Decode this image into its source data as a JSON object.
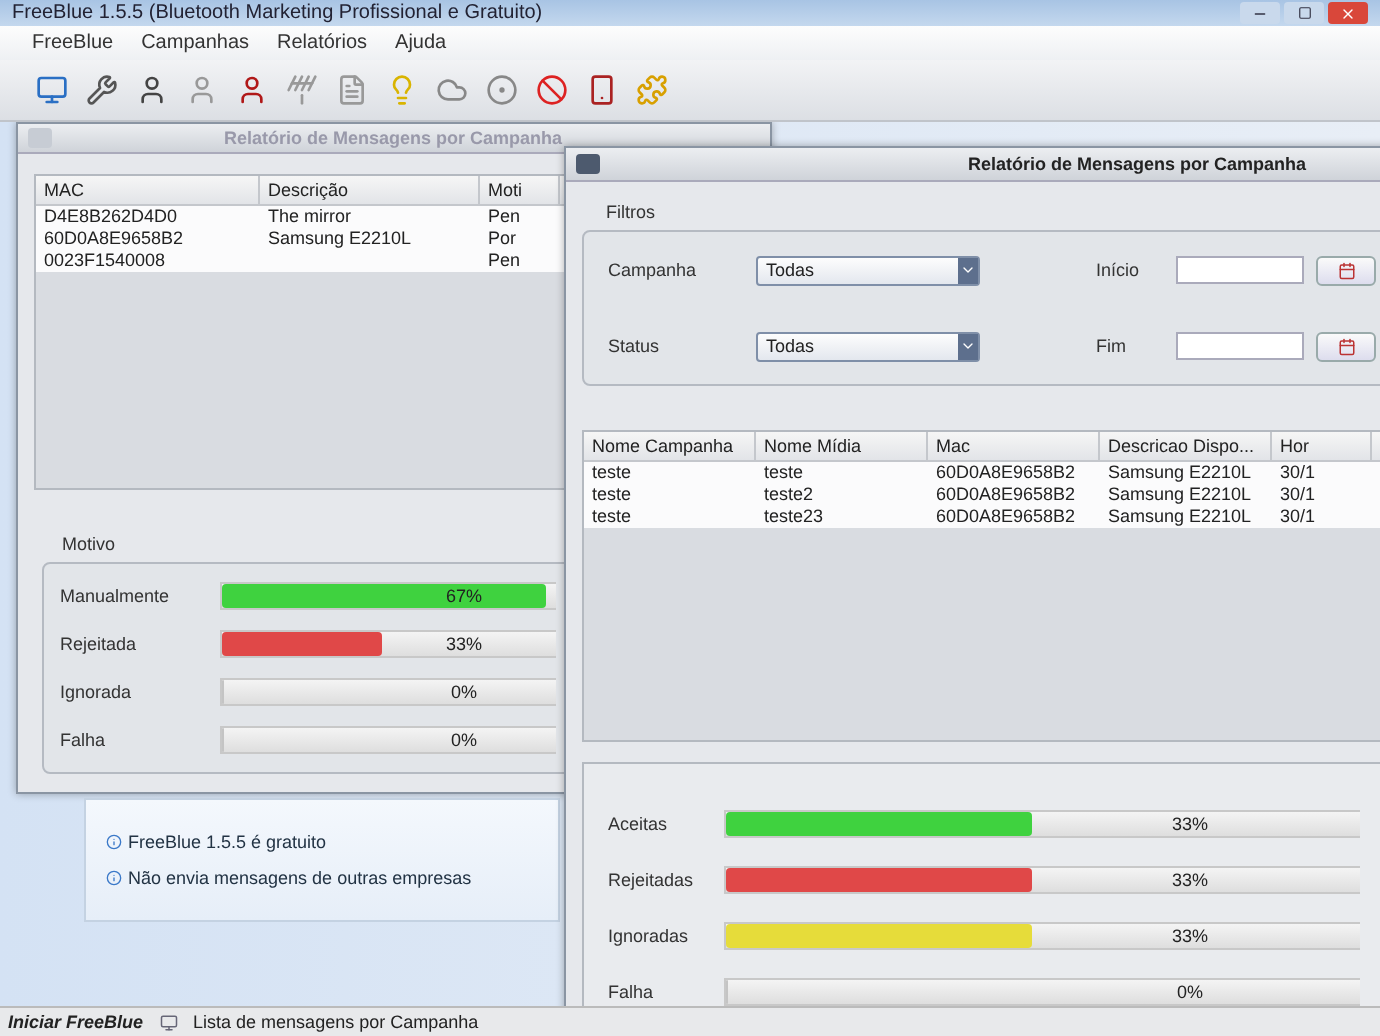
{
  "window": {
    "title": "FreeBlue 1.5.5 (Bluetooth Marketing Profissional e Gratuito)"
  },
  "menu": [
    "FreeBlue",
    "Campanhas",
    "Relatórios",
    "Ajuda"
  ],
  "back_report": {
    "title": "Relatório de Mensagens por Campanha",
    "columns": [
      "MAC",
      "Descrição",
      "Moti"
    ],
    "rows": [
      [
        "D4E8B262D4D0",
        "The mirror",
        "Pen"
      ],
      [
        "60D0A8E9658B2",
        "Samsung E2210L",
        "Por"
      ],
      [
        "0023F1540008",
        "",
        "Pen"
      ]
    ],
    "reasons_label": "Motivo",
    "bars": [
      {
        "label": "Manualmente",
        "level": 0.67,
        "reading": "67%",
        "color": "#3fd23f"
      },
      {
        "label": "Rejeitada",
        "level": 0.33,
        "reading": "33%",
        "color": "#e04848"
      },
      {
        "label": "Ignorada",
        "level": 0,
        "reading": "0%"
      },
      {
        "label": "Falha",
        "level": 0,
        "reading": "0%"
      }
    ]
  },
  "info": [
    "FreeBlue 1.5.5 é gratuito",
    "Não envia mensagens de outras empresas"
  ],
  "front_report": {
    "title": "Relatório de Mensagens por Campanha",
    "filters_label": "Filtros",
    "campaign": {
      "label": "Campanha",
      "value": "Todas"
    },
    "status": {
      "label": "Status",
      "value": "Todas"
    },
    "start": {
      "label": "Início"
    },
    "end": {
      "label": "Fim"
    },
    "columns": [
      "Nome Campanha",
      "Nome Mídia",
      "Mac",
      "Descricao Dispo...",
      "Hor"
    ],
    "rows": [
      [
        "teste",
        "teste",
        "60D0A8E9658B2",
        "Samsung E2210L",
        "30/1"
      ],
      [
        "teste",
        "teste2",
        "60D0A8E9658B2",
        "Samsung E2210L",
        "30/1"
      ],
      [
        "teste",
        "teste23",
        "60D0A8E9658B2",
        "Samsung E2210L",
        "30/1"
      ]
    ],
    "bars": [
      {
        "label": "Aceitas",
        "level": 0.33,
        "reading": "33%",
        "color": "#3fd23f"
      },
      {
        "label": "Rejeitadas",
        "level": 0.33,
        "reading": "33%",
        "color": "#e04848"
      },
      {
        "label": "Ignoradas",
        "level": 0.33,
        "reading": "33%",
        "color": "#e6dc3a"
      },
      {
        "label": "Falha",
        "level": 0,
        "reading": "0%"
      }
    ]
  },
  "status_bar": {
    "start": "Iniciar FreeBlue",
    "task": "Lista de mensagens por Campanha"
  }
}
